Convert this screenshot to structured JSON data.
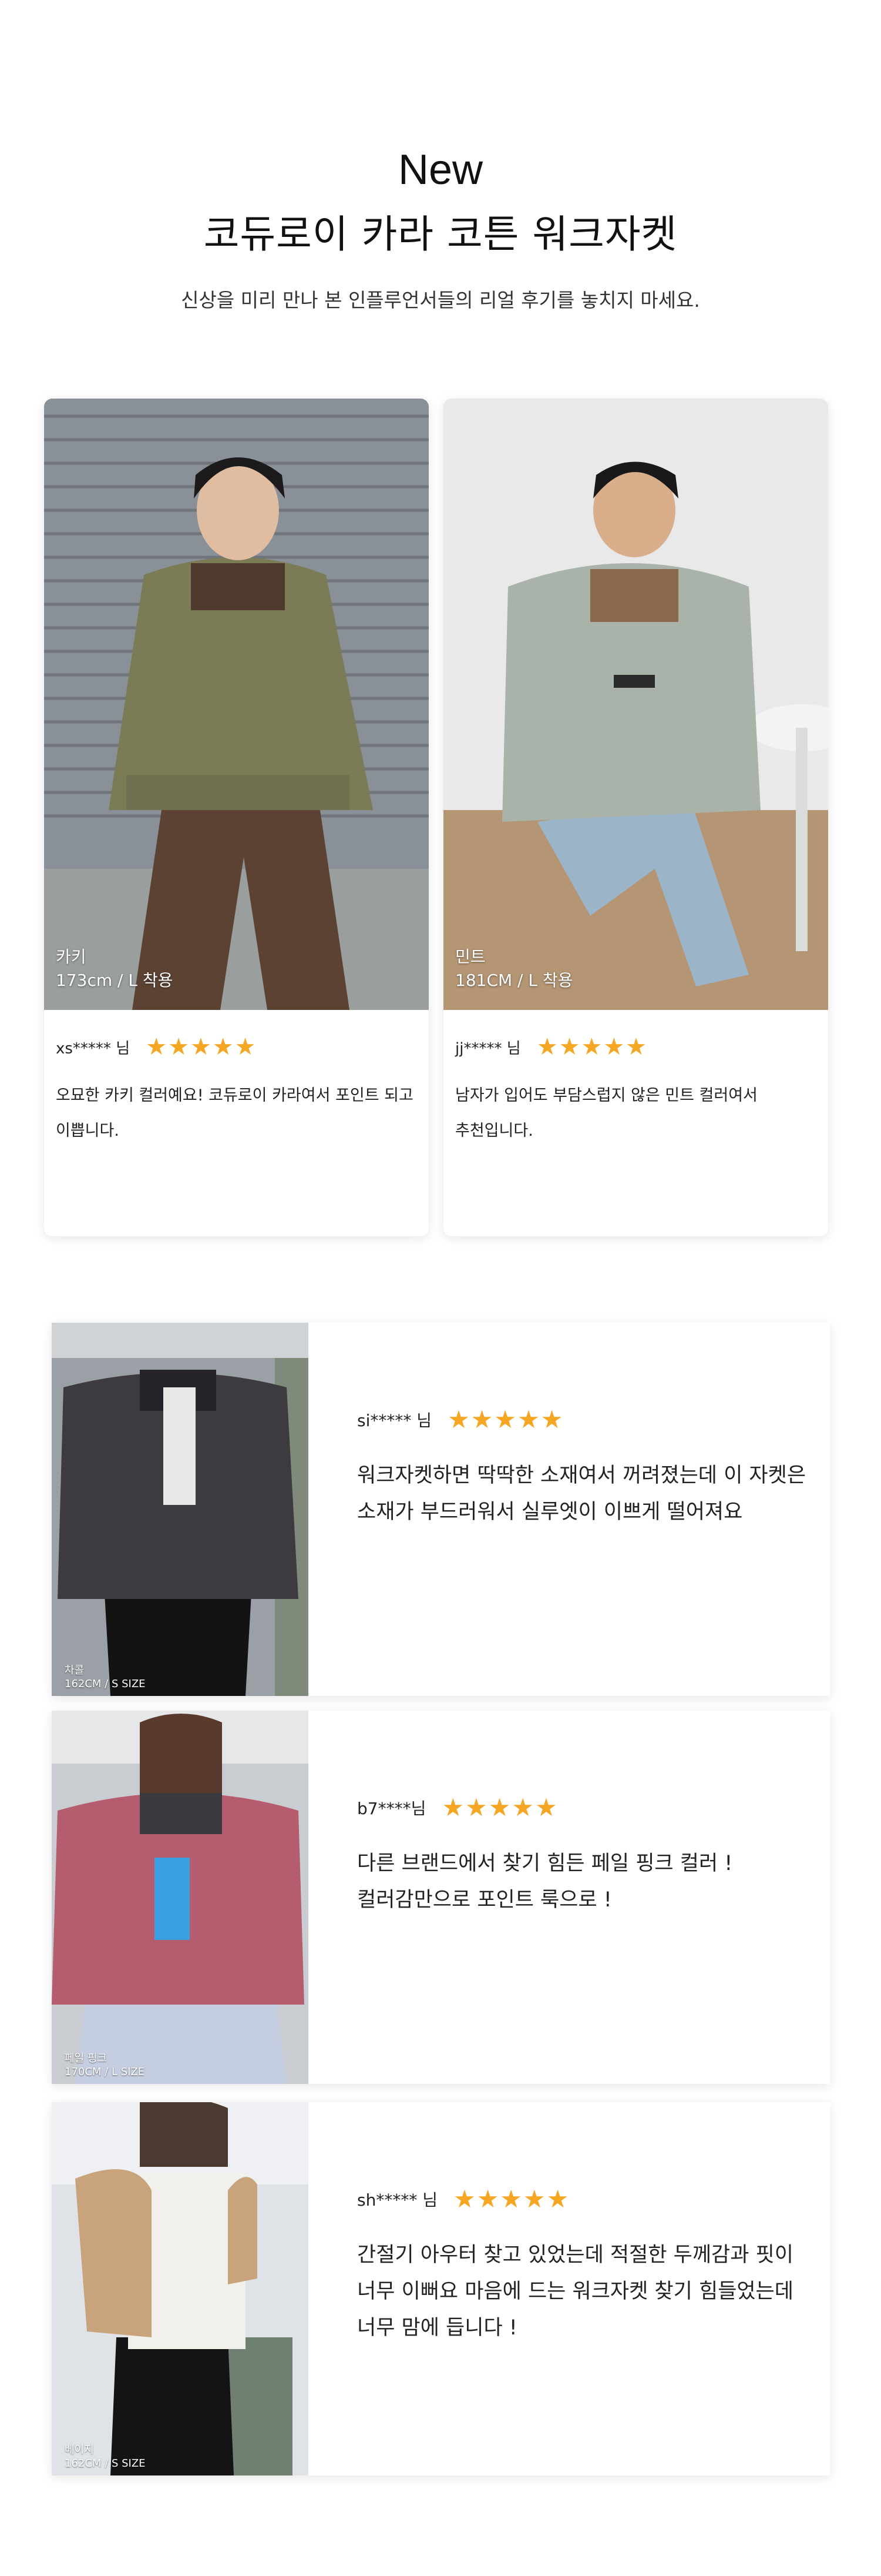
{
  "hero": {
    "new_label": "New",
    "title": "코듀로이 카라 코튼 워크자켓",
    "subtitle": "신상을 미리 만나 본 인플루언서들의 리얼 후기를 놓치지 마세요."
  },
  "top_reviews": [
    {
      "photo_color": "카키",
      "photo_size": "173cm / L 착용",
      "reviewer": "xs***** 님",
      "rating": 5,
      "stars": "★★★★★",
      "text_line1": "오묘한 카키 컬러예요! 코듀로이 카라여서 포인트 되고",
      "text_line2": "이쁩니다."
    },
    {
      "photo_color": "민트",
      "photo_size": "181CM / L 착용",
      "reviewer": "jj***** 님",
      "rating": 5,
      "stars": "★★★★★",
      "text_line1": "남자가 입어도 부담스럽지 않은 민트 컬러여서",
      "text_line2": "추천입니다."
    }
  ],
  "row_reviews": [
    {
      "photo_color": "차콜",
      "photo_size": "162CM / S SIZE",
      "reviewer": "si***** 님",
      "rating": 5,
      "stars": "★★★★★",
      "text_line1": "워크자켓하면 딱딱한 소재여서 꺼려졌는데 이 자켓은",
      "text_line2": "소재가 부드러워서 실루엣이 이쁘게 떨어져요",
      "text_line3": ""
    },
    {
      "photo_color": "페일 핑크",
      "photo_size": "170CM / L SIZE",
      "reviewer": "b7****님",
      "rating": 5,
      "stars": "★★★★★",
      "text_line1": "다른 브랜드에서 찾기 힘든 페일 핑크 컬러 !",
      "text_line2": "컬러감만으로 포인트 룩으로 !",
      "text_line3": ""
    },
    {
      "photo_color": "베이지",
      "photo_size": "162CM / S SIZE",
      "reviewer": "sh***** 님",
      "rating": 5,
      "stars": "★★★★★",
      "text_line1": "간절기 아우터 찾고 있었는데 적절한 두께감과 핏이",
      "text_line2": "너무 이뻐요 마음에 드는 워크자켓 찾기 힘들었는데",
      "text_line3": "너무 맘에 듭니다 !"
    }
  ],
  "colors": {
    "star": "#f5a623",
    "khaki_jacket": "#7b7c55",
    "mint_jacket": "#a9b3a9",
    "charcoal_jacket": "#3d3b40",
    "pink_jacket": "#b55d6f",
    "beige_jacket": "#c8a37c"
  }
}
